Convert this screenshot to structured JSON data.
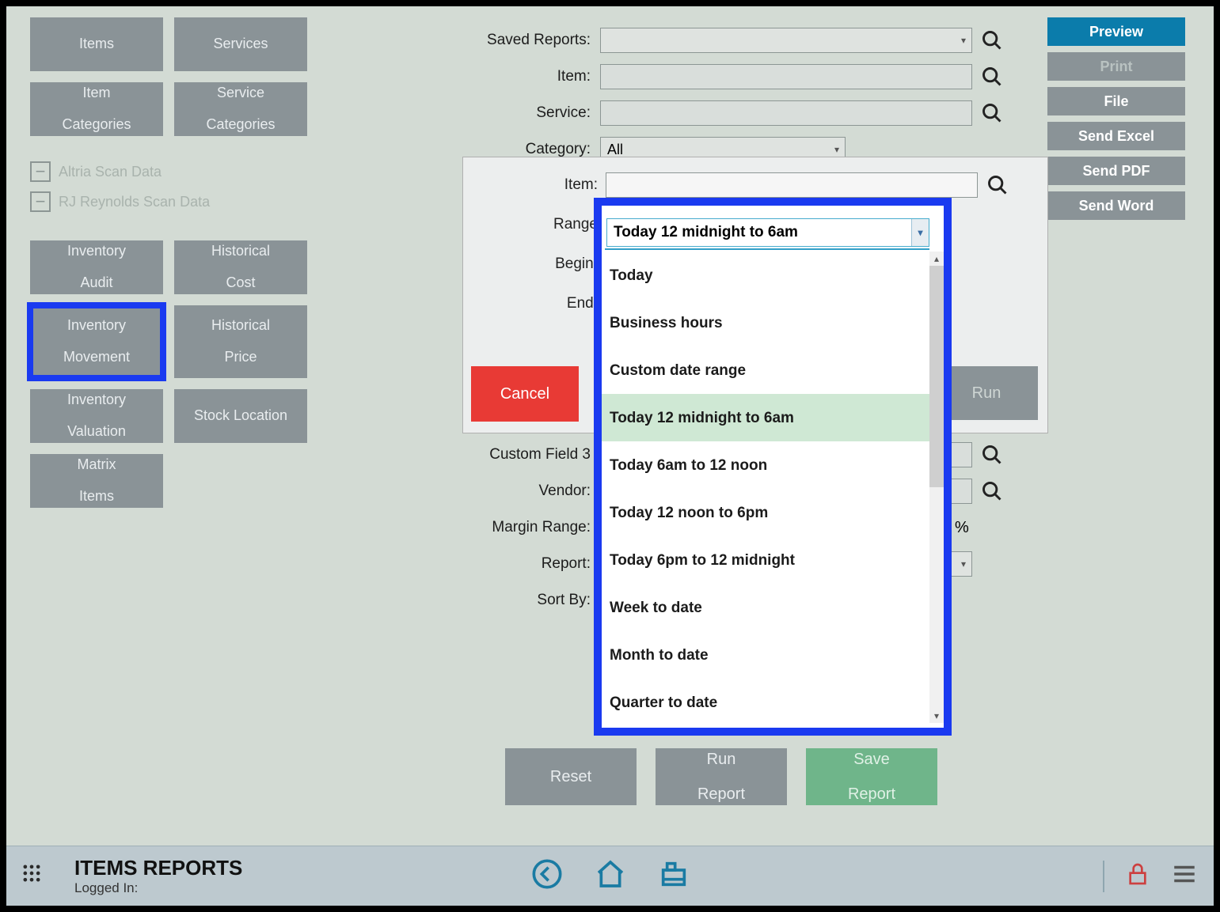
{
  "sidebar": {
    "row1": {
      "items": "Items",
      "services": "Services"
    },
    "row2": {
      "item_cat": "Item\nCategories",
      "service_cat": "Service\nCategories"
    },
    "scan": {
      "altria": "Altria Scan Data",
      "rj": "RJ Reynolds Scan Data"
    },
    "grid": {
      "inv_audit": "Inventory\nAudit",
      "hist_cost": "Historical\nCost",
      "inv_move": "Inventory\nMovement",
      "hist_price": "Historical\nPrice",
      "inv_val": "Inventory\nValuation",
      "stock_loc": "Stock Location",
      "matrix": "Matrix\nItems"
    }
  },
  "actions": {
    "preview": "Preview",
    "print": "Print",
    "file": "File",
    "excel": "Send Excel",
    "pdf": "Send PDF",
    "word": "Send Word"
  },
  "form": {
    "saved_reports": "Saved Reports:",
    "item": "Item:",
    "service": "Service:",
    "category": "Category:",
    "category_val": "All",
    "custom3": "Custom Field 3",
    "vendor": "Vendor:",
    "margin": "Margin Range:",
    "pct": "%",
    "report": "Report:",
    "sort": "Sort By:"
  },
  "modal": {
    "item": "Item:",
    "range": "Range",
    "range_val": "Today 12 midnight to 6am",
    "begin": "Begin:",
    "end": "End:",
    "cancel": "Cancel",
    "run": "Run"
  },
  "dropdown": {
    "selected": "Today 12 midnight to 6am",
    "opts": [
      "Today",
      "Business hours",
      "Custom date range",
      "Today 12 midnight to 6am",
      "Today 6am to 12 noon",
      "Today 12 noon to 6pm",
      "Today 6pm to 12 midnight",
      "Week to date",
      "Month to date",
      "Quarter to date"
    ]
  },
  "bottom": {
    "reset": "Reset",
    "run": "Run\nReport",
    "save": "Save\nReport"
  },
  "footer": {
    "title": "ITEMS REPORTS",
    "logged": "Logged In:"
  }
}
